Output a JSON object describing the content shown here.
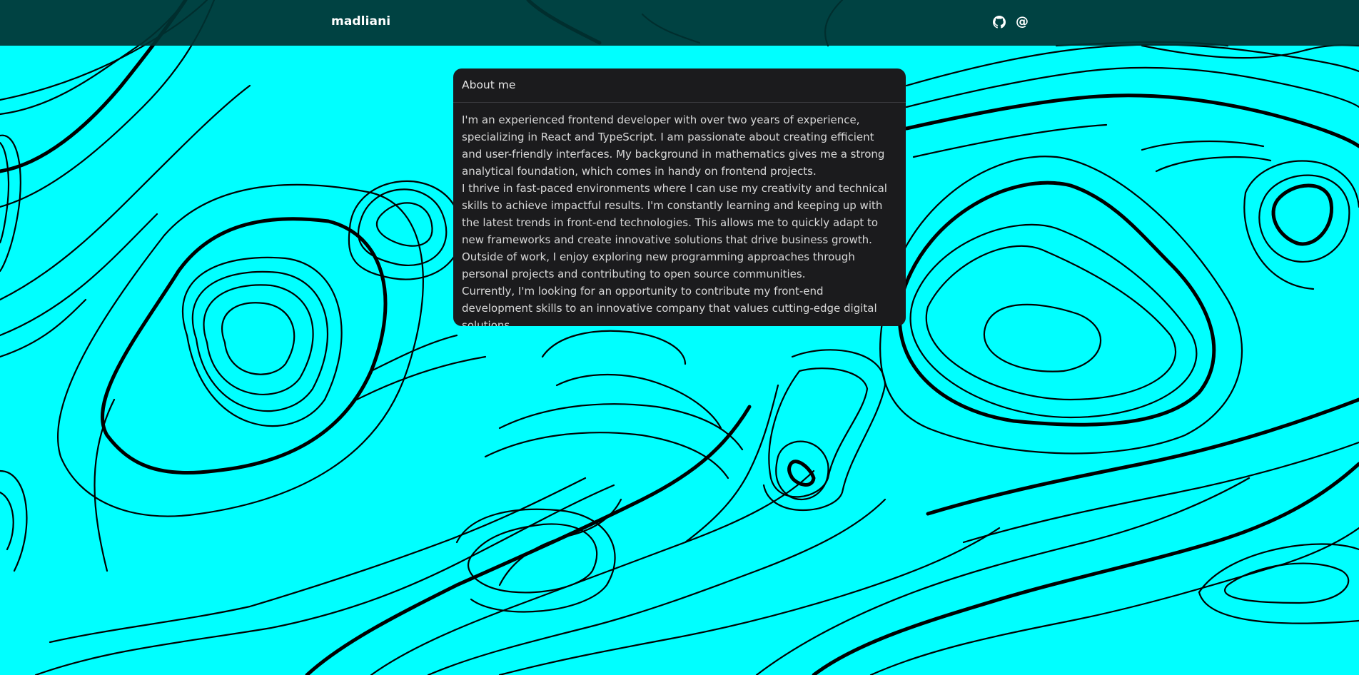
{
  "header": {
    "brand": "madliani",
    "icons": [
      "github-icon",
      "at-icon"
    ],
    "at_symbol": "@"
  },
  "about": {
    "title": "About me",
    "paragraphs": [
      "I'm an experienced frontend developer with over two years of experience, specializing in React and TypeScript. I am passionate about creating efficient and user-friendly interfaces. My background in mathematics gives me a strong analytical foundation, which comes in handy on frontend projects.",
      "I thrive in fast-paced environments where I can use my creativity and technical skills to achieve impactful results. I'm constantly learning and keeping up with the latest trends in front-end technologies. This allows me to quickly adapt to new frameworks and create innovative solutions that drive business growth.",
      "Outside of work, I enjoy exploring new programming approaches through personal projects and contributing to open source communities.",
      "Currently, I'm looking for an opportunity to contribute my front-end development skills to an innovative company that values cutting-edge digital solutions."
    ]
  },
  "colors": {
    "background": "#00ffff",
    "contour": "#000000",
    "topbar": "#003232",
    "card": "#1b1b1d",
    "text": "#d8d8d8"
  }
}
